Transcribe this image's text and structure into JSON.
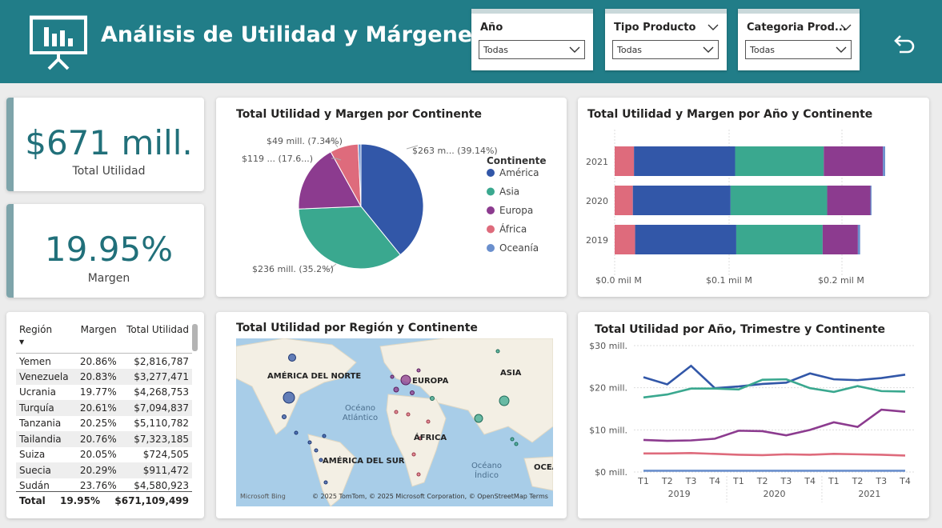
{
  "header": {
    "title": "Análisis de Utilidad y Márgenes",
    "slicers": [
      {
        "label": "Año",
        "value": "Todas"
      },
      {
        "label": "Tipo Producto",
        "value": "Todas"
      },
      {
        "label": "Categoria Prod...",
        "value": "Todas"
      }
    ]
  },
  "kpis": {
    "utilidad": {
      "value": "$671 mill.",
      "label": "Total Utilidad"
    },
    "margen": {
      "value": "19.95%",
      "label": "Margen"
    }
  },
  "colors": {
    "header": "#217d88",
    "america": "#3257a8",
    "asia": "#3aa88f",
    "europa": "#8c3b8f",
    "africa": "#de6b7c",
    "oceania": "#6a8fcd"
  },
  "table": {
    "columns": [
      "Región",
      "Margen",
      "Total Utilidad"
    ],
    "rows": [
      [
        "Yemen",
        "20.86%",
        "$2,816,787"
      ],
      [
        "Venezuela",
        "20.83%",
        "$3,277,471"
      ],
      [
        "Ucrania",
        "19.77%",
        "$4,268,753"
      ],
      [
        "Turquía",
        "20.61%",
        "$7,094,837"
      ],
      [
        "Tanzania",
        "20.25%",
        "$5,110,782"
      ],
      [
        "Tailandia",
        "20.76%",
        "$7,323,185"
      ],
      [
        "Suiza",
        "20.05%",
        "$724,505"
      ],
      [
        "Suecia",
        "20.29%",
        "$911,472"
      ],
      [
        "Sudán",
        "23.76%",
        "$4,580,923"
      ]
    ],
    "total": [
      "Total",
      "19.95%",
      "$671,109,499"
    ]
  },
  "pie": {
    "title": "Total Utilidad y Margen por Continente",
    "legend_title": "Continente",
    "labels": [
      "$263 m... (39.14%)",
      "$236 mill. (35.2%)",
      "$119 ... (17.6...)",
      "$49 mill. (7.34%)"
    ]
  },
  "map": {
    "title": "Total Utilidad por Región y Continente",
    "labels": [
      "AMÉRICA DEL NORTE",
      "EUROPA",
      "ASIA",
      "ÁFRICA",
      "AMÉRICA DEL SUR",
      "OCEA"
    ],
    "oceans": [
      "Océano Atlántico",
      "Océano Índico"
    ],
    "bing": "Microsoft Bing",
    "credit": "© 2025 TomTom, © 2025 Microsoft Corporation, © OpenStreetMap  Terms"
  },
  "stacked_bar": {
    "title": "Total Utilidad y Margen por Año y Continente",
    "x_ticks": [
      "$0.0 mil M",
      "$0.1 mil M",
      "$0.2 mil M"
    ]
  },
  "line": {
    "title": "Total Utilidad por Año, Trimestre y Continente",
    "y_ticks": [
      "$30 mill.",
      "$20 mill.",
      "$10 mill.",
      "$0 mill."
    ],
    "quarters": [
      "T1",
      "T2",
      "T3",
      "T4"
    ],
    "years": [
      "2019",
      "2020",
      "2021"
    ]
  },
  "chart_data": [
    {
      "type": "pie",
      "title": "Total Utilidad y Margen por Continente",
      "categories": [
        "América",
        "Asia",
        "Europa",
        "África",
        "Oceanía"
      ],
      "values": [
        39.14,
        35.2,
        17.6,
        7.34,
        0.72
      ],
      "data_labels": [
        "$263 m... (39.14%)",
        "$236 mill. (35.2%)",
        "$119 ... (17.6...)",
        "$49 mill. (7.34%)",
        ""
      ]
    },
    {
      "type": "bar",
      "title": "Total Utilidad y Margen por Año y Continente",
      "categories": [
        "2021",
        "2020",
        "2019"
      ],
      "xlim": [
        0,
        0.22
      ],
      "series": [
        {
          "name": "África",
          "values": [
            0.017,
            0.016,
            0.018
          ]
        },
        {
          "name": "América",
          "values": [
            0.089,
            0.086,
            0.089
          ]
        },
        {
          "name": "Asia",
          "values": [
            0.078,
            0.085,
            0.076
          ]
        },
        {
          "name": "Europa",
          "values": [
            0.052,
            0.038,
            0.031
          ]
        },
        {
          "name": "Oceanía",
          "values": [
            0.002,
            0.001,
            0.002
          ]
        }
      ]
    },
    {
      "type": "line",
      "title": "Total Utilidad por Año, Trimestre y Continente",
      "x": [
        "2019 T1",
        "2019 T2",
        "2019 T3",
        "2019 T4",
        "2020 T1",
        "2020 T2",
        "2020 T3",
        "2020 T4",
        "2021 T1",
        "2021 T2",
        "2021 T3",
        "2021 T4"
      ],
      "ylim": [
        0,
        30
      ],
      "series": [
        {
          "name": "América",
          "values": [
            22.5,
            20.8,
            25.2,
            19.9,
            20.3,
            20.9,
            21.2,
            23.4,
            22.0,
            21.8,
            22.3,
            23.1
          ]
        },
        {
          "name": "Asia",
          "values": [
            17.7,
            18.4,
            19.8,
            19.8,
            19.6,
            21.9,
            22.0,
            19.9,
            19.0,
            20.4,
            19.2,
            19.1
          ]
        },
        {
          "name": "Europa",
          "values": [
            7.6,
            7.4,
            7.5,
            7.9,
            9.8,
            9.7,
            8.7,
            10.0,
            11.8,
            10.7,
            14.8,
            14.3
          ]
        },
        {
          "name": "África",
          "values": [
            4.4,
            4.4,
            4.5,
            4.3,
            4.1,
            4.0,
            4.2,
            4.1,
            4.3,
            4.2,
            4.1,
            3.9
          ]
        },
        {
          "name": "Oceanía",
          "values": [
            0.3,
            0.3,
            0.3,
            0.3,
            0.3,
            0.3,
            0.3,
            0.3,
            0.3,
            0.3,
            0.3,
            0.3
          ]
        }
      ]
    }
  ]
}
